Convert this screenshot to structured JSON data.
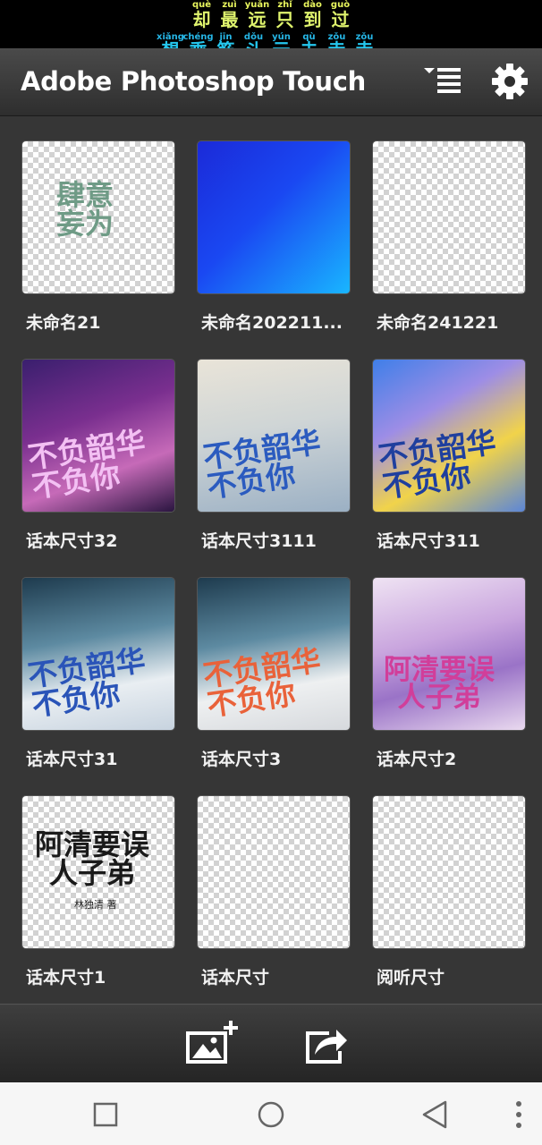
{
  "lyrics": {
    "line1": [
      {
        "py": "què",
        "hz": "却"
      },
      {
        "py": "zuì",
        "hz": "最"
      },
      {
        "py": "yuǎn",
        "hz": "远"
      },
      {
        "py": "zhǐ",
        "hz": "只"
      },
      {
        "py": "dào",
        "hz": "到"
      },
      {
        "py": "guò",
        "hz": "过"
      }
    ],
    "line2": [
      {
        "py": "xiǎng",
        "hz": "想"
      },
      {
        "py": "chéng",
        "hz": "乘"
      },
      {
        "py": "jīn",
        "hz": "筋"
      },
      {
        "py": "dǒu",
        "hz": "斗"
      },
      {
        "py": "yún",
        "hz": "云"
      },
      {
        "py": "qù",
        "hz": "去"
      },
      {
        "py": "zǒu",
        "hz": "走"
      },
      {
        "py": "zǒu",
        "hz": "走"
      }
    ]
  },
  "header": {
    "title": "Adobe Photoshop Touch",
    "sort_icon": "sort-list-icon",
    "settings_icon": "gear-icon"
  },
  "projects": [
    {
      "name": "未命名21",
      "art_text": "肆意\n妄为"
    },
    {
      "name": "未命名202211..."
    },
    {
      "name": "未命名241221"
    },
    {
      "name": "话本尺寸32",
      "art_text": "不负韶华\n不负你"
    },
    {
      "name": "话本尺寸3111",
      "art_text": "不负韶华\n不负你"
    },
    {
      "name": "话本尺寸311",
      "art_text": "不负韶华\n不负你"
    },
    {
      "name": "话本尺寸31",
      "art_text": "不负韶华\n不负你"
    },
    {
      "name": "话本尺寸3",
      "art_text": "不负韶华\n不负你"
    },
    {
      "name": "话本尺寸2",
      "art_text": "阿清要误\n人子弟"
    },
    {
      "name": "话本尺寸1",
      "art_text": "阿清要误\n人子弟",
      "art_sub": "林独清 著"
    },
    {
      "name": "话本尺寸"
    },
    {
      "name": "阅听尺寸"
    }
  ],
  "toolbar": {
    "add_icon": "add-image-icon",
    "share_icon": "share-icon"
  },
  "navbar": {
    "recents_icon": "square-icon",
    "home_icon": "circle-icon",
    "back_icon": "triangle-back-icon",
    "menu_icon": "more-dots-icon"
  },
  "colors": {
    "background": "#363636",
    "titlebar": "#3a3a3a",
    "accent_blue": "#1a3cf0"
  }
}
